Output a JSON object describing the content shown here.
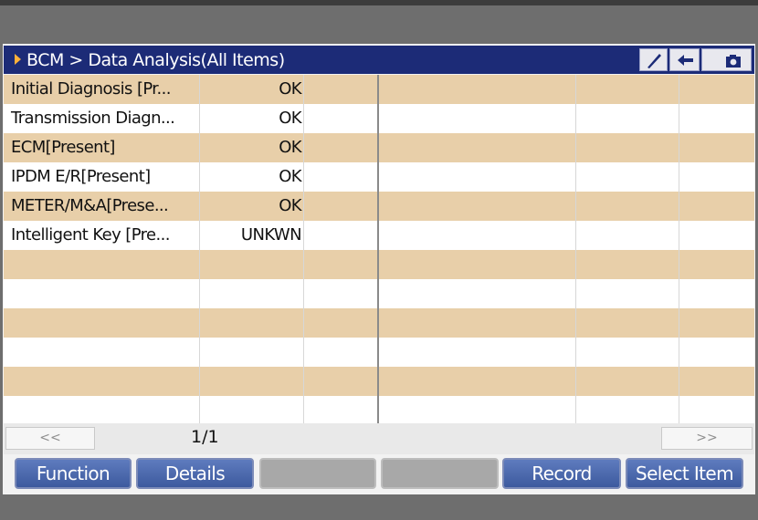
{
  "header": {
    "title": "BCM > Data Analysis(All Items)",
    "buttons": [
      {
        "name": "edit-button",
        "icon": "pen-icon"
      },
      {
        "name": "back-button",
        "icon": "back-arrow-icon"
      },
      {
        "name": "camera-button",
        "icon": "camera-icon"
      }
    ]
  },
  "table": {
    "rows": [
      {
        "name": "Initial Diagnosis [Pr...",
        "value": "OK"
      },
      {
        "name": "Transmission Diagn...",
        "value": "OK"
      },
      {
        "name": "ECM[Present]",
        "value": "OK"
      },
      {
        "name": "IPDM E/R[Present]",
        "value": "OK"
      },
      {
        "name": "METER/M&A[Prese...",
        "value": "OK"
      },
      {
        "name": "Intelligent Key [Pre...",
        "value": "UNKWN"
      },
      {
        "name": "",
        "value": ""
      },
      {
        "name": "",
        "value": ""
      },
      {
        "name": "",
        "value": ""
      },
      {
        "name": "",
        "value": ""
      },
      {
        "name": "",
        "value": ""
      },
      {
        "name": "",
        "value": ""
      }
    ]
  },
  "pager": {
    "prev_label": "<<",
    "next_label": ">>",
    "page": "1/1"
  },
  "footer": {
    "function": "Function",
    "details": "Details",
    "record": "Record",
    "select_item": "Select Item"
  },
  "colors": {
    "title_bar": "#1c2b77",
    "row_highlight": "#e8cfa9",
    "button_blue": "#4a67aa",
    "button_disabled": "#a8a8a8"
  }
}
